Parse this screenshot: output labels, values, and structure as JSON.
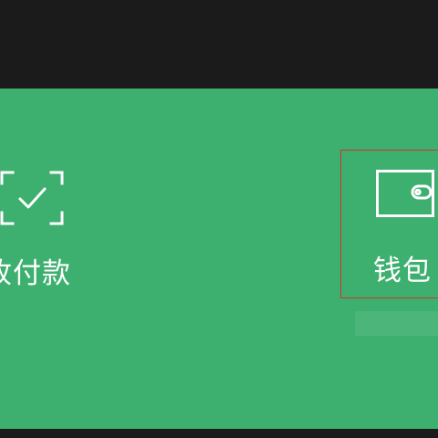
{
  "colors": {
    "panel": "#3daf6e",
    "dark_bar": "#1b1b1b",
    "text": "#ffffff",
    "highlight_border": "#d2332b"
  },
  "tiles": [
    {
      "label": "收付款",
      "icon": "scan-check-icon"
    },
    {
      "label": "钱包",
      "icon": "wallet-icon"
    }
  ]
}
